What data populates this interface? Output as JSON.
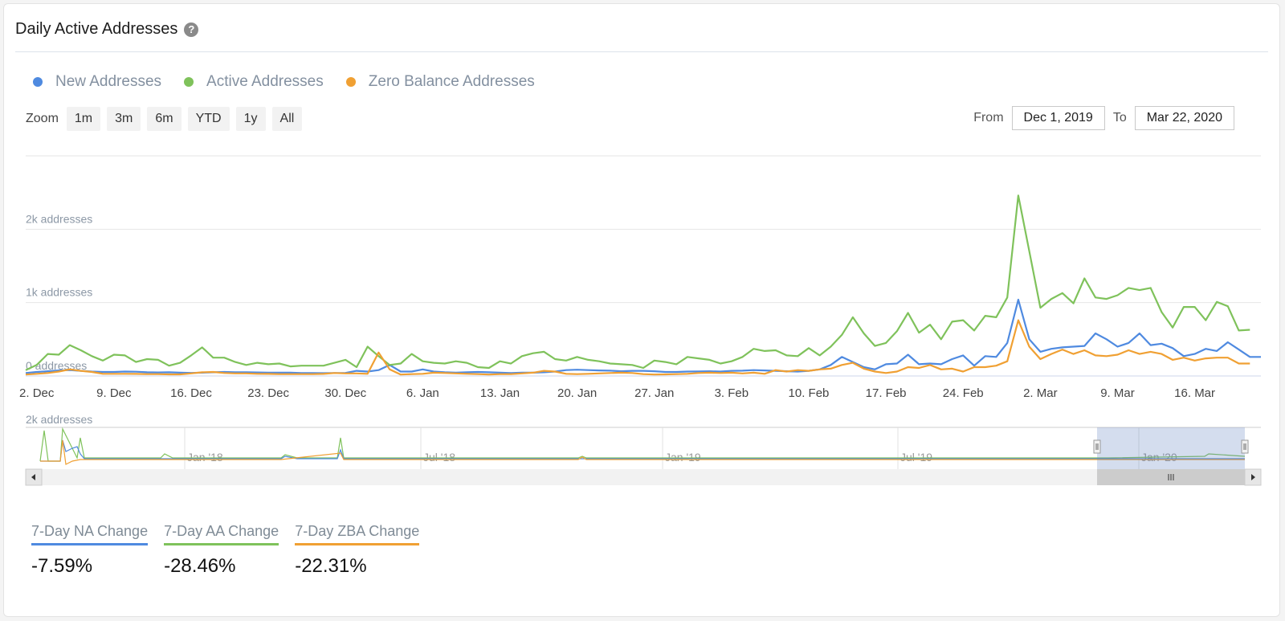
{
  "header": {
    "title": "Daily Active Addresses",
    "help_icon": "question-circle-icon"
  },
  "legend": [
    {
      "label": "New Addresses",
      "color": "#4f8ae0"
    },
    {
      "label": "Active Addresses",
      "color": "#7fc25b"
    },
    {
      "label": "Zero Balance Addresses",
      "color": "#f0a033"
    }
  ],
  "zoom": {
    "label": "Zoom",
    "buttons": [
      "1m",
      "3m",
      "6m",
      "YTD",
      "1y",
      "All"
    ]
  },
  "range": {
    "from_label": "From",
    "from_value": "Dec 1, 2019",
    "to_label": "To",
    "to_value": "Mar 22, 2020"
  },
  "stats": [
    {
      "label": "7-Day NA Change",
      "value": "-7.59%",
      "color": "#4f8ae0"
    },
    {
      "label": "7-Day AA Change",
      "value": "-28.46%",
      "color": "#7fc25b"
    },
    {
      "label": "7-Day ZBA Change",
      "value": "-22.31%",
      "color": "#f0a033"
    }
  ],
  "chart_data": {
    "type": "line",
    "title": "Daily Active Addresses",
    "x_start": "2019-12-01",
    "x_end": "2020-03-22",
    "xlabel": "",
    "ylabel": "addresses",
    "ylim": [
      0,
      3000
    ],
    "yticks": [
      0,
      1000,
      2000,
      3000
    ],
    "ytick_labels": [
      "0 addresses",
      "1k addresses",
      "2k addresses",
      ""
    ],
    "xtick_labels": [
      "2. Dec",
      "9. Dec",
      "16. Dec",
      "23. Dec",
      "30. Dec",
      "6. Jan",
      "13. Jan",
      "20. Jan",
      "27. Jan",
      "3. Feb",
      "10. Feb",
      "17. Feb",
      "24. Feb",
      "2. Mar",
      "9. Mar",
      "16. Mar"
    ],
    "xtick_days": [
      1,
      8,
      15,
      22,
      29,
      36,
      43,
      50,
      57,
      64,
      71,
      78,
      85,
      92,
      99,
      106
    ],
    "grid": true,
    "legend_position": "top-left",
    "series": [
      {
        "name": "New Addresses",
        "color": "#4f8ae0",
        "values": [
          40,
          55,
          65,
          75,
          80,
          70,
          60,
          55,
          55,
          60,
          58,
          50,
          48,
          50,
          45,
          42,
          45,
          50,
          55,
          50,
          52,
          48,
          45,
          45,
          45,
          40,
          40,
          38,
          40,
          42,
          70,
          60,
          80,
          150,
          60,
          60,
          90,
          60,
          50,
          45,
          50,
          55,
          50,
          45,
          40,
          45,
          45,
          50,
          60,
          80,
          85,
          80,
          75,
          72,
          65,
          70,
          70,
          65,
          55,
          55,
          60,
          62,
          65,
          60,
          70,
          72,
          80,
          75,
          70,
          65,
          60,
          70,
          90,
          150,
          260,
          190,
          120,
          90,
          160,
          170,
          290,
          160,
          170,
          160,
          230,
          280,
          140,
          270,
          260,
          450,
          1040,
          500,
          330,
          370,
          390,
          400,
          410,
          580,
          500,
          400,
          450,
          580,
          420,
          440,
          380,
          270,
          300,
          370,
          340,
          460,
          360,
          260,
          260
        ]
      },
      {
        "name": "Active Addresses",
        "color": "#7fc25b",
        "values": [
          80,
          150,
          300,
          290,
          420,
          350,
          270,
          210,
          290,
          280,
          190,
          230,
          220,
          140,
          180,
          280,
          390,
          250,
          250,
          190,
          150,
          180,
          160,
          170,
          130,
          140,
          140,
          140,
          180,
          220,
          120,
          400,
          270,
          150,
          170,
          300,
          200,
          180,
          170,
          200,
          180,
          120,
          110,
          200,
          170,
          270,
          310,
          330,
          230,
          210,
          260,
          220,
          200,
          170,
          160,
          150,
          110,
          210,
          190,
          160,
          260,
          240,
          220,
          170,
          200,
          260,
          370,
          340,
          350,
          280,
          270,
          380,
          280,
          400,
          560,
          800,
          580,
          410,
          450,
          610,
          860,
          590,
          700,
          500,
          740,
          760,
          620,
          820,
          800,
          1070,
          2460,
          1700,
          930,
          1050,
          1130,
          990,
          1330,
          1070,
          1050,
          1100,
          1200,
          1170,
          1200,
          870,
          660,
          940,
          940,
          760,
          1010,
          950,
          620,
          630
        ]
      },
      {
        "name": "Zero Balance Addresses",
        "color": "#f0a033",
        "values": [
          20,
          30,
          40,
          60,
          90,
          70,
          55,
          30,
          30,
          30,
          28,
          25,
          25,
          22,
          22,
          35,
          50,
          55,
          40,
          35,
          35,
          30,
          28,
          25,
          25,
          25,
          25,
          28,
          40,
          35,
          35,
          30,
          320,
          90,
          20,
          25,
          30,
          45,
          40,
          35,
          30,
          25,
          20,
          25,
          25,
          35,
          45,
          70,
          60,
          30,
          25,
          30,
          35,
          40,
          45,
          40,
          25,
          20,
          22,
          25,
          30,
          40,
          45,
          40,
          45,
          35,
          45,
          30,
          80,
          60,
          80,
          70,
          90,
          100,
          150,
          180,
          100,
          60,
          40,
          60,
          120,
          110,
          150,
          90,
          100,
          60,
          120,
          120,
          140,
          200,
          760,
          400,
          230,
          300,
          360,
          300,
          350,
          280,
          270,
          290,
          350,
          300,
          330,
          300,
          220,
          250,
          210,
          240,
          250,
          250,
          170,
          170
        ]
      }
    ],
    "navigator": {
      "xtick_labels": [
        "Jan '18",
        "Jul '18",
        "Jan '19",
        "Jul '19",
        "Jan '20"
      ],
      "ytick_label": "2k addresses",
      "selected_range": [
        "Dec 1, 2019",
        "Mar 22, 2020"
      ]
    }
  }
}
